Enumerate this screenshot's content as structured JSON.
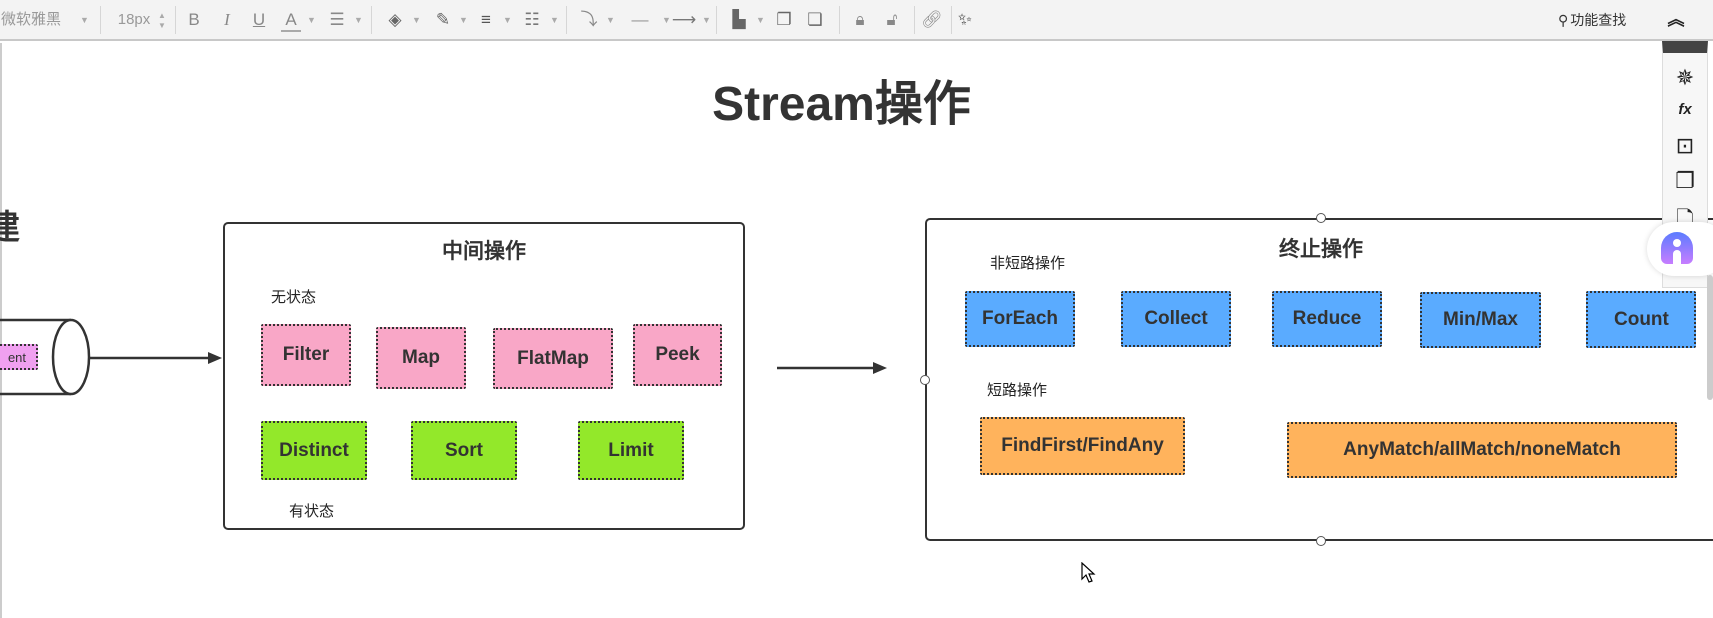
{
  "toolbar": {
    "font_family": "微软雅黑",
    "font_size": "18px",
    "bold": "B",
    "italic": "I",
    "underline": "U",
    "font_color": "A",
    "search_label": "功能查找"
  },
  "diagram": {
    "title": "Stream操作",
    "left_partial_title": "建",
    "left_partial_node": "ent",
    "intermediate": {
      "title": "中间操作",
      "stateless_label": "无状态",
      "stateful_label": "有状态",
      "stateless_ops": [
        "Filter",
        "Map",
        "FlatMap",
        "Peek"
      ],
      "stateful_ops": [
        "Distinct",
        "Sort",
        "Limit"
      ]
    },
    "terminal": {
      "title": "终止操作",
      "non_short_label": "非短路操作",
      "short_label": "短路操作",
      "non_short_ops": [
        "ForEach",
        "Collect",
        "Reduce",
        "Min/Max",
        "Count"
      ],
      "short_ops": [
        "FindFirst/FindAny",
        "AnyMatch/allMatch/noneMatch"
      ]
    }
  },
  "colors": {
    "stateless": "#f9a7c7",
    "stateful": "#93e82a",
    "non_short": "#5aabff",
    "short": "#ffb35c",
    "partial_node": "#f0a0f0"
  }
}
